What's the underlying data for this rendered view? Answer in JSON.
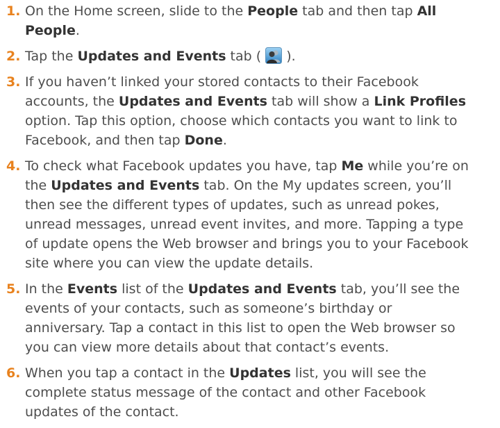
{
  "steps": [
    {
      "num": "1.",
      "parts": [
        {
          "t": "On the Home screen, slide to the "
        },
        {
          "t": "People",
          "b": true
        },
        {
          "t": " tab and then tap "
        },
        {
          "t": "All People",
          "b": true
        },
        {
          "t": "."
        }
      ]
    },
    {
      "num": "2.",
      "parts": [
        {
          "t": "Tap the "
        },
        {
          "t": "Updates and Events",
          "b": true
        },
        {
          "t": " tab ( "
        },
        {
          "icon": "updates-events-tab-icon"
        },
        {
          "t": " )."
        }
      ]
    },
    {
      "num": "3.",
      "parts": [
        {
          "t": "If you haven’t linked your stored contacts to their Facebook accounts, the "
        },
        {
          "t": "Updates and Events",
          "b": true
        },
        {
          "t": " tab will show a "
        },
        {
          "t": "Link Profiles",
          "b": true
        },
        {
          "t": " option. Tap this option, choose which contacts you want to link to Facebook, and then tap "
        },
        {
          "t": "Done",
          "b": true
        },
        {
          "t": "."
        }
      ]
    },
    {
      "num": "4.",
      "parts": [
        {
          "t": "To check what Facebook updates you have, tap "
        },
        {
          "t": "Me",
          "b": true
        },
        {
          "t": " while you’re on the "
        },
        {
          "t": "Updates and Events",
          "b": true
        },
        {
          "t": " tab. On the My updates screen, you’ll then see the different types of updates, such as unread pokes, unread messages, unread event invites, and more. Tapping a type of update opens the Web browser and brings you to your Facebook site where you can view the update details."
        }
      ]
    },
    {
      "num": "5.",
      "parts": [
        {
          "t": "In the "
        },
        {
          "t": "Events",
          "b": true
        },
        {
          "t": " list of the "
        },
        {
          "t": "Updates and Events",
          "b": true
        },
        {
          "t": " tab, you’ll see the events of your contacts, such as someone’s birthday or anniversary. Tap a contact in this list to open the Web browser so you can view more details about that contact’s events."
        }
      ]
    },
    {
      "num": "6.",
      "parts": [
        {
          "t": "When you tap a contact in the "
        },
        {
          "t": "Updates",
          "b": true
        },
        {
          "t": " list, you will see the complete status message of the contact and other Facebook updates of the contact."
        }
      ]
    }
  ]
}
